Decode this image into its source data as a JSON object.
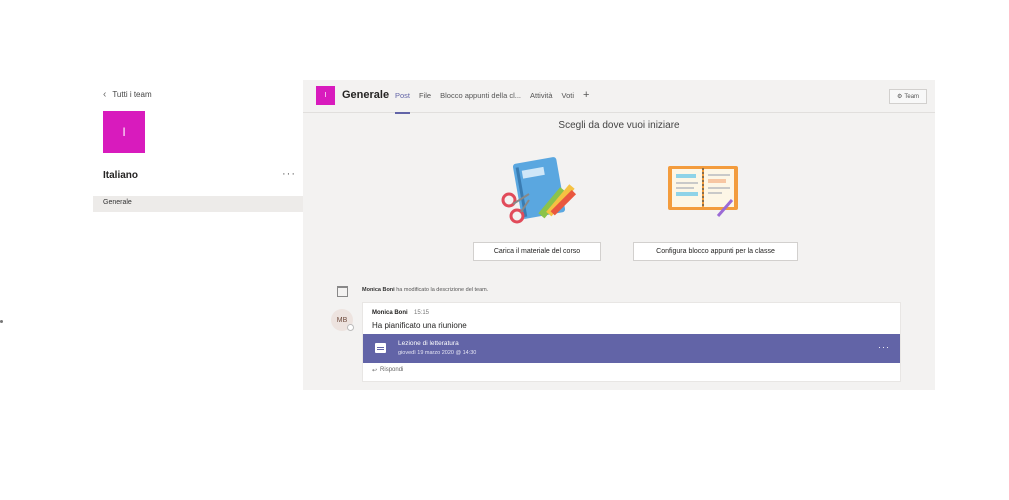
{
  "left_panel": {
    "back_label": "Tutti i team",
    "team_initial": "I",
    "team_name": "Italiano",
    "more_label": "···",
    "channels": [
      {
        "label": "Generale"
      }
    ]
  },
  "channel": {
    "initial": "I",
    "title": "Generale",
    "tabs": [
      {
        "label": "Post",
        "active": true
      },
      {
        "label": "File"
      },
      {
        "label": "Blocco appunti della cl..."
      },
      {
        "label": "Attività"
      },
      {
        "label": "Voti"
      }
    ],
    "add_tab": "+",
    "team_button": "Team"
  },
  "start": {
    "title": "Scegli da dove vuoi iniziare",
    "button_material": "Carica il materiale del corso",
    "button_notebook": "Configura blocco appunti per la classe"
  },
  "feed": {
    "system_author": "Monica Boni",
    "system_message": "ha modificato la descrizione del team.",
    "post": {
      "avatar": "MB",
      "author": "Monica Boni",
      "time": "15:15",
      "text": "Ha pianificato una riunione",
      "meeting_title": "Lezione di letteratura",
      "meeting_date": "giovedì 19 marzo 2020 @ 14:30",
      "meeting_more": "···",
      "reply_label": "Rispondi"
    }
  },
  "colors": {
    "accent": "#6264a7",
    "team_tile": "#d81bbd",
    "background_pane": "#f3f2f1"
  },
  "icons": {
    "back": "chevron-left-icon",
    "calendar": "calendar-icon",
    "reply": "reply-arrow-icon",
    "system": "team-update-icon",
    "team": "team-icon"
  }
}
